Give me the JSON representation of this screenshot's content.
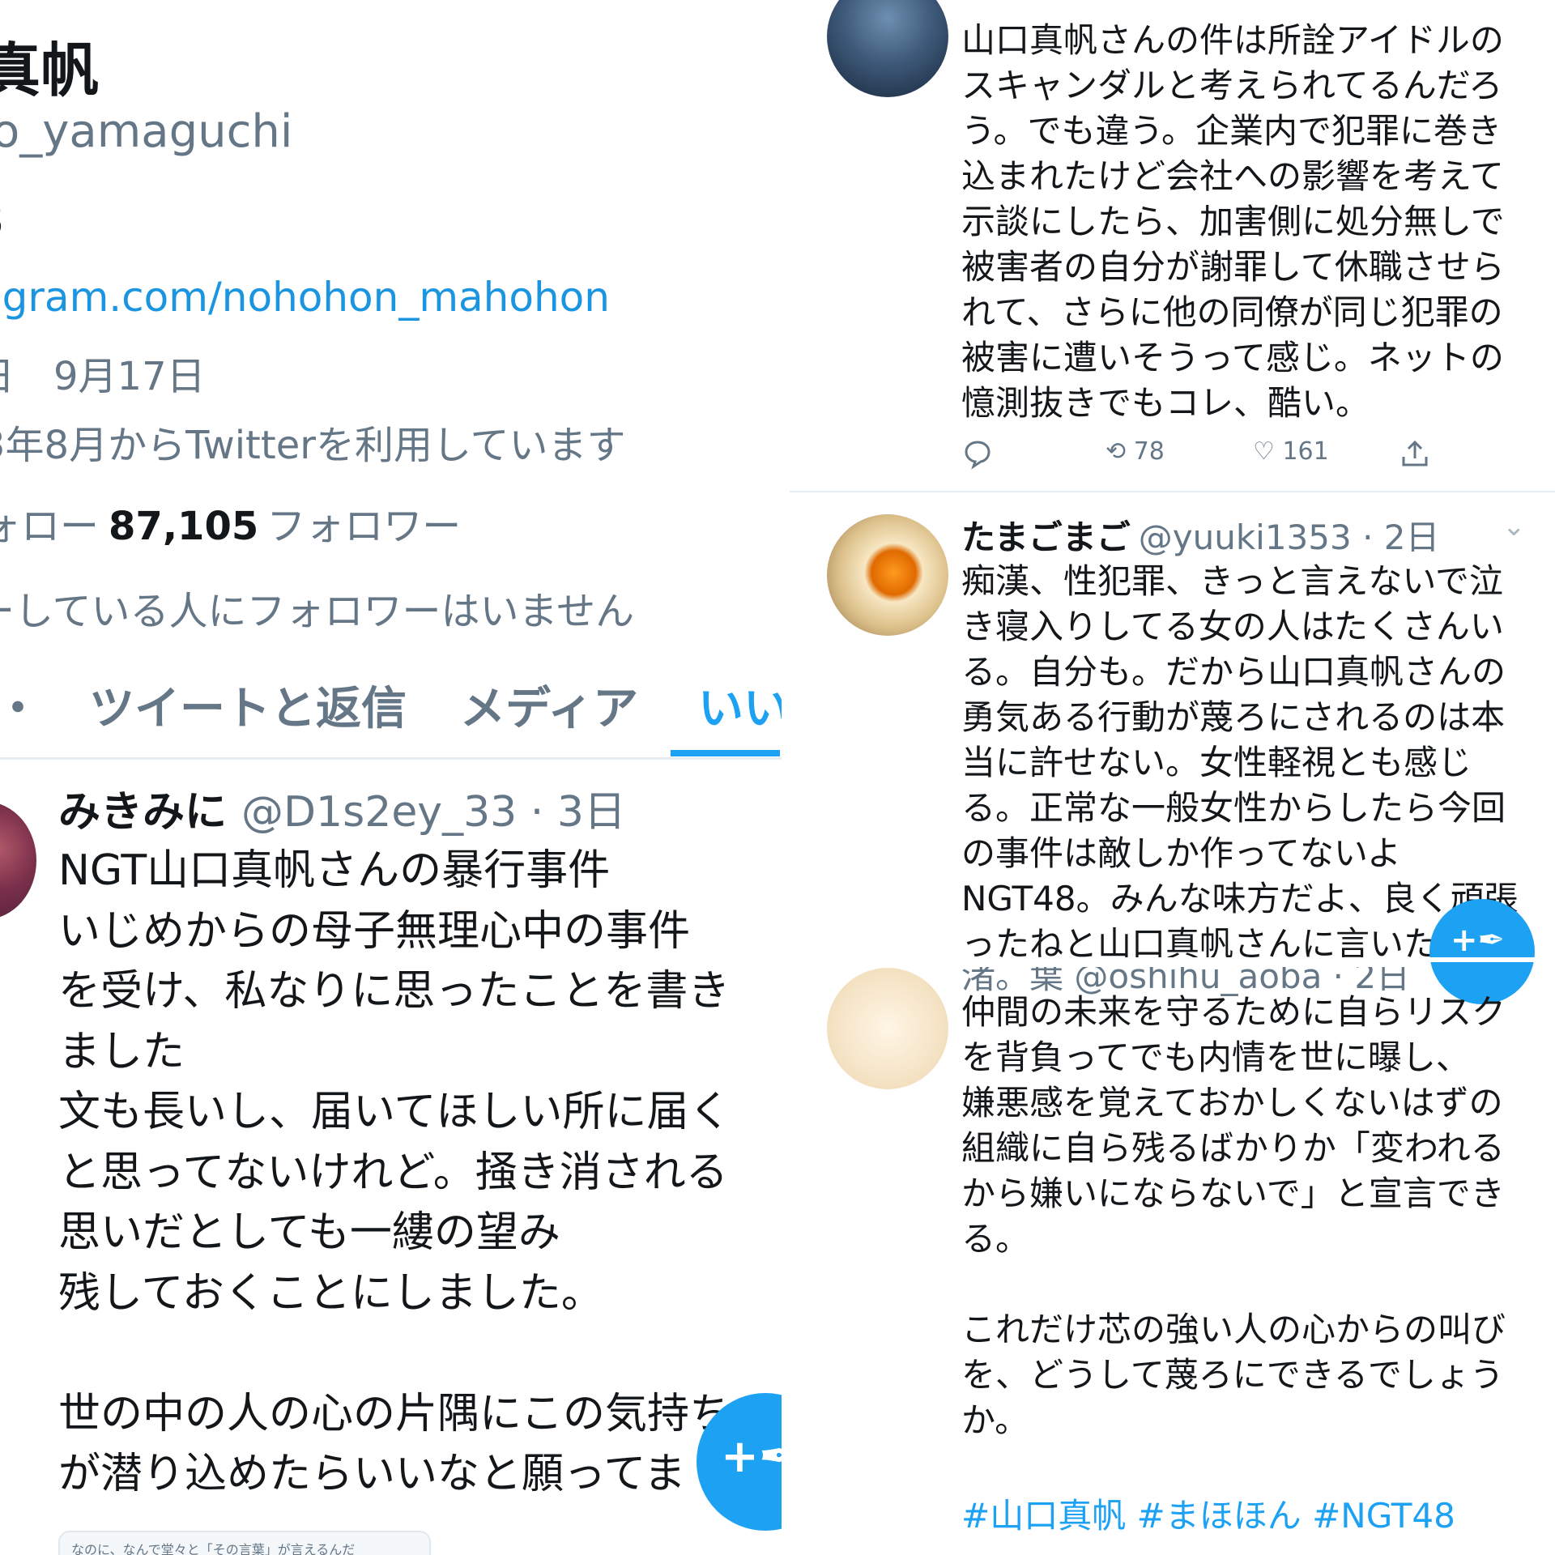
{
  "left": {
    "profile": {
      "name": "真帆",
      "handle": "o_yamaguchi",
      "bio_fragment": "3",
      "link": "agram.com/nohohon_mahohon",
      "birthday": "日　9月17日",
      "joined": "3年8月からTwitterを利用しています",
      "follow_prefix": "ォロー",
      "followers_count": "87,105",
      "followers_label": "フォロワー",
      "known_followers": "ーしている人にフォロワーはいません"
    },
    "tabs": [
      {
        "label": "・"
      },
      {
        "label": "ツイートと返信"
      },
      {
        "label": "メディア"
      },
      {
        "label": "いい"
      }
    ],
    "tweet": {
      "name": "みきみに",
      "handle": "@D1s2ey_33 · 3日",
      "body": "NGT山口真帆さんの暴行事件\nいじめからの母子無理心中の事件\nを受け、私なりに思ったことを書き\nました\n文も長いし、届いてほしい所に届く\nと思ってないけれど。掻き消される\n思いだとしても一縷の望み\n残しておくことにしました。\n\n世の中の人の心の片隅にこの気持ち\nが潜り込めたらいいなと願ってま",
      "card_text": "なのに、なんで堂々と「その言葉」が言えるんだ"
    },
    "fab_icon": "compose-icon"
  },
  "right": {
    "tweets": [
      {
        "body": "山口真帆さんの件は所詮アイドルの\nスキャンダルと考えられてるんだろ\nう。でも違う。企業内で犯罪に巻き\n込まれたけど会社への影響を考えて\n示談にしたら、加害側に処分無しで\n被害者の自分が謝罪して休職させら\nれて、さらに他の同僚が同じ犯罪の\n被害に遭いそうって感じ。ネットの\n憶測抜きでもコレ、酷い。",
        "retweets": "78",
        "likes": "161"
      },
      {
        "name": "たまごまご",
        "handle": "@yuuki1353 · 2日",
        "body": "痴漢、性犯罪、きっと言えないで泣\nき寝入りしてる女の人はたくさんい\nる。自分も。だから山口真帆さんの\n勇気ある行動が蔑ろにされるのは本\n当に許せない。女性軽視とも感じ\nる。正常な一般女性からしたら今回\nの事件は敵しか作ってないよ\nNGT48。みんな味方だよ、良く頑張\nったねと山口真帆さんに言いたい"
      },
      {
        "name": "渚。葉",
        "handle": "@oshihu_aoba · 2日",
        "body": "仲間の未来を守るために自らリスク\nを背負ってでも内情を世に曝し、\n嫌悪感を覚えておかしくないはずの\n組織に自ら残るばかりか「変われる\nから嫌いにならないで」と宣言でき\nる。\n\nこれだけ芯の強い人の心からの叫び\nを、どうして蔑ろにできるでしょう\nか。",
        "hashtags": "#山口真帆 #まほほん #NGT48"
      }
    ]
  },
  "colors": {
    "accent": "#1da1f2",
    "text": "#14171a",
    "secondary_text": "#657786",
    "link": "#1b95e0"
  }
}
